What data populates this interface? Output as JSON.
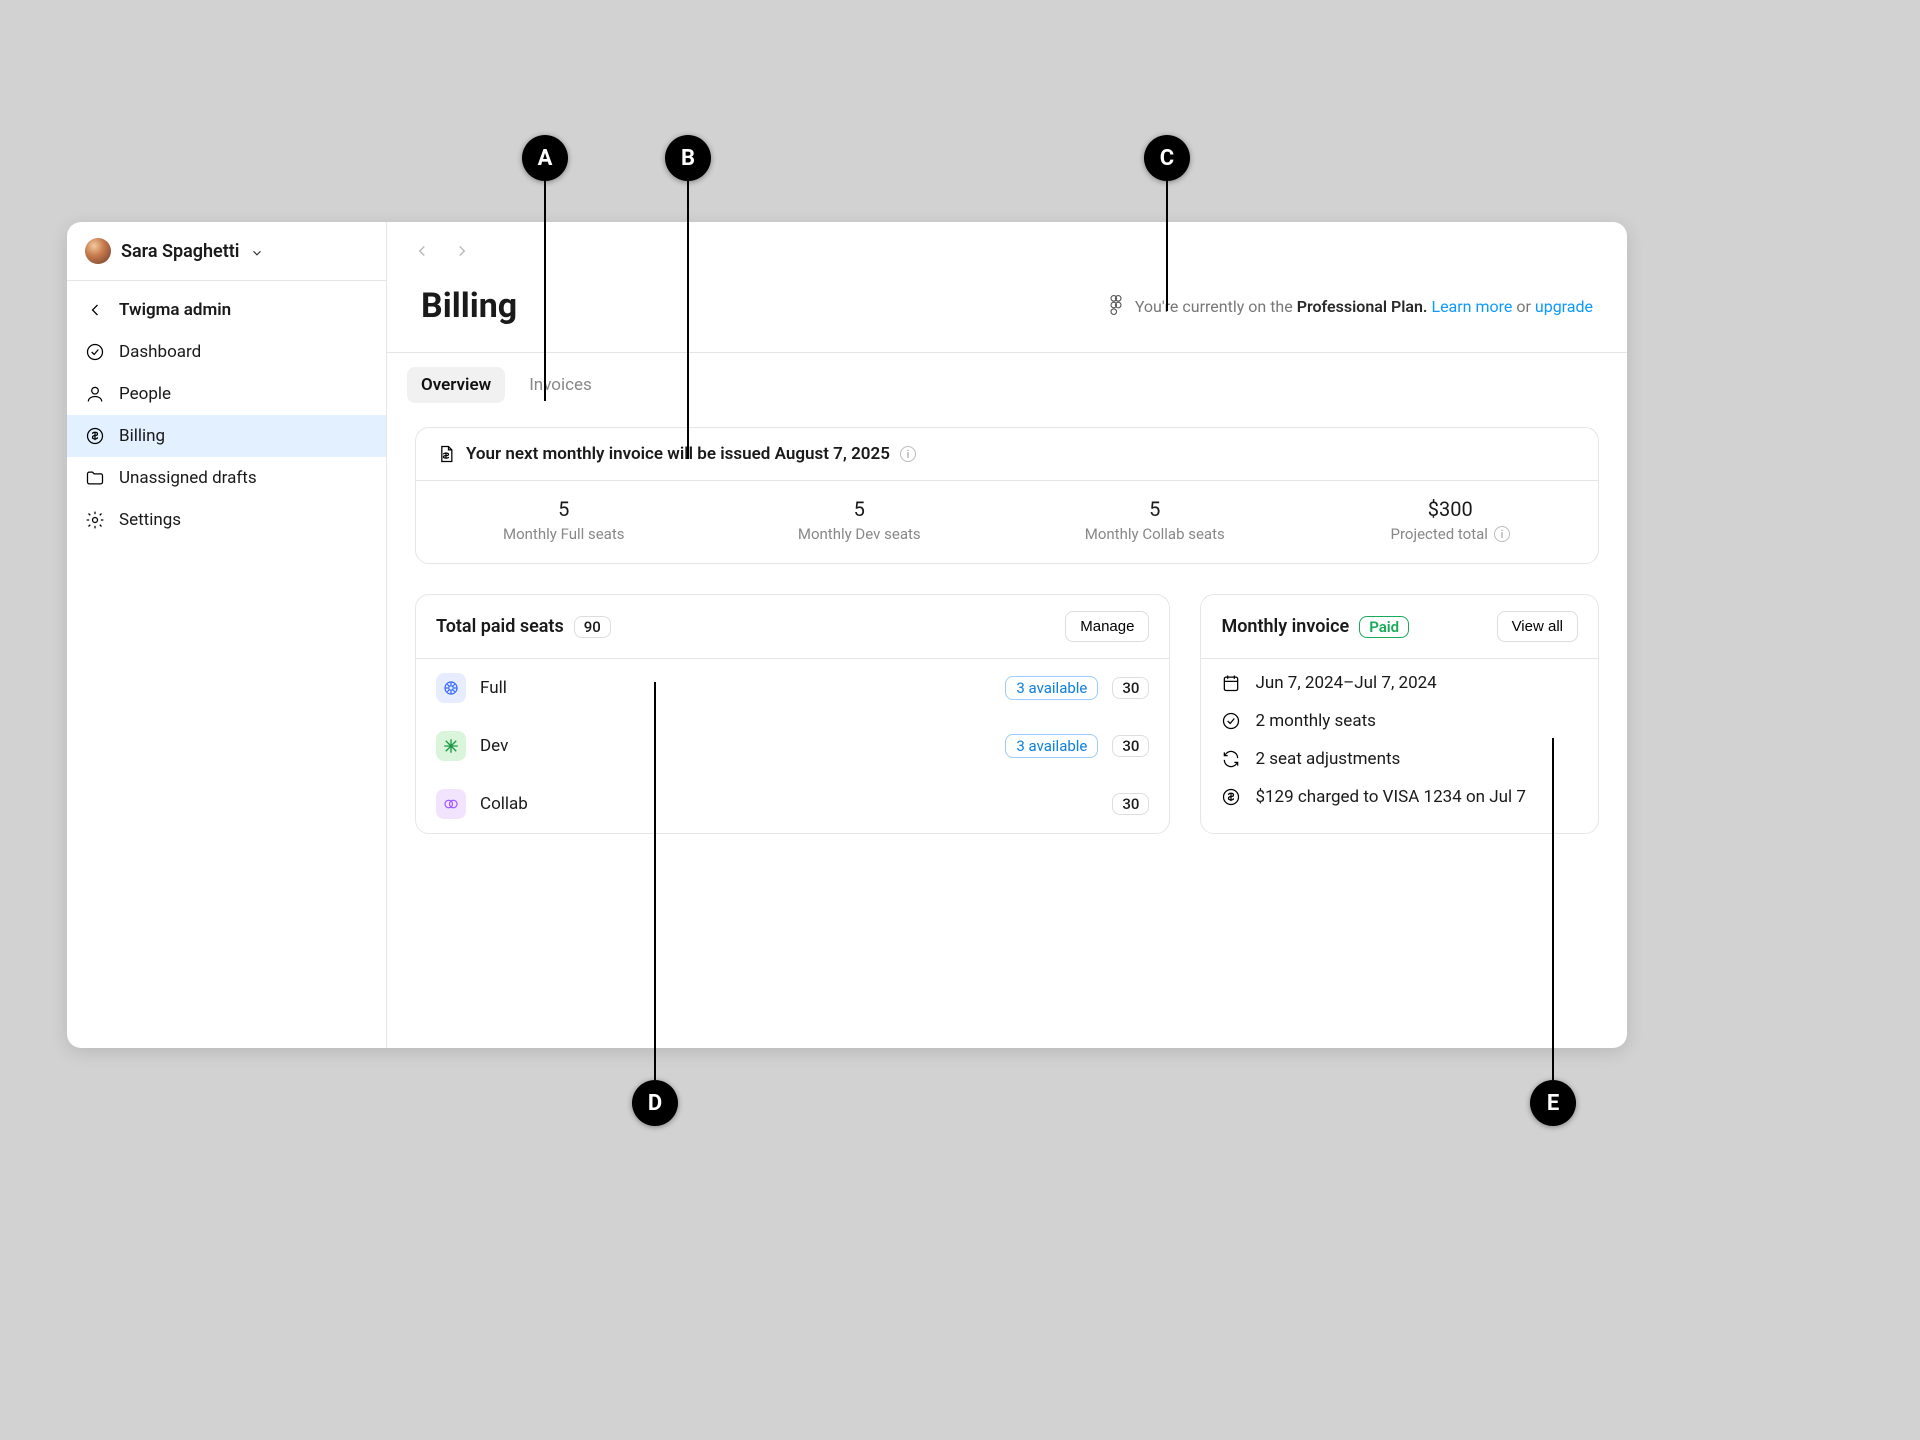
{
  "user": {
    "name": "Sara Spaghetti"
  },
  "nav": {
    "back": "Twigma admin",
    "items": [
      {
        "label": "Dashboard"
      },
      {
        "label": "People"
      },
      {
        "label": "Billing"
      },
      {
        "label": "Unassigned drafts"
      },
      {
        "label": "Settings"
      }
    ]
  },
  "header": {
    "title": "Billing",
    "plan_prefix": "You're currently on the ",
    "plan_name": "Professional Plan.",
    "learn_more": "Learn more",
    "or": " or ",
    "upgrade": "upgrade"
  },
  "tabs": {
    "overview": "Overview",
    "invoices": "Invoices"
  },
  "next_invoice": {
    "message": "Your next monthly invoice will be issued August 7, 2025",
    "stats": [
      {
        "value": "5",
        "label": "Monthly Full seats"
      },
      {
        "value": "5",
        "label": "Monthly Dev seats"
      },
      {
        "value": "5",
        "label": "Monthly Collab seats"
      },
      {
        "value": "$300",
        "label": "Projected total"
      }
    ]
  },
  "seats": {
    "title": "Total paid seats",
    "total": "90",
    "manage": "Manage",
    "rows": [
      {
        "name": "Full",
        "available": "3 available",
        "count": "30"
      },
      {
        "name": "Dev",
        "available": "3 available",
        "count": "30"
      },
      {
        "name": "Collab",
        "available": "",
        "count": "30"
      }
    ]
  },
  "monthly_invoice": {
    "title": "Monthly invoice",
    "status": "Paid",
    "view_all": "View all",
    "lines": [
      "Jun 7, 2024–Jul 7, 2024",
      "2 monthly seats",
      "2 seat adjustments",
      "$129 charged to VISA 1234 on Jul 7"
    ]
  },
  "callouts": {
    "a": "A",
    "b": "B",
    "c": "C",
    "d": "D",
    "e": "E"
  }
}
